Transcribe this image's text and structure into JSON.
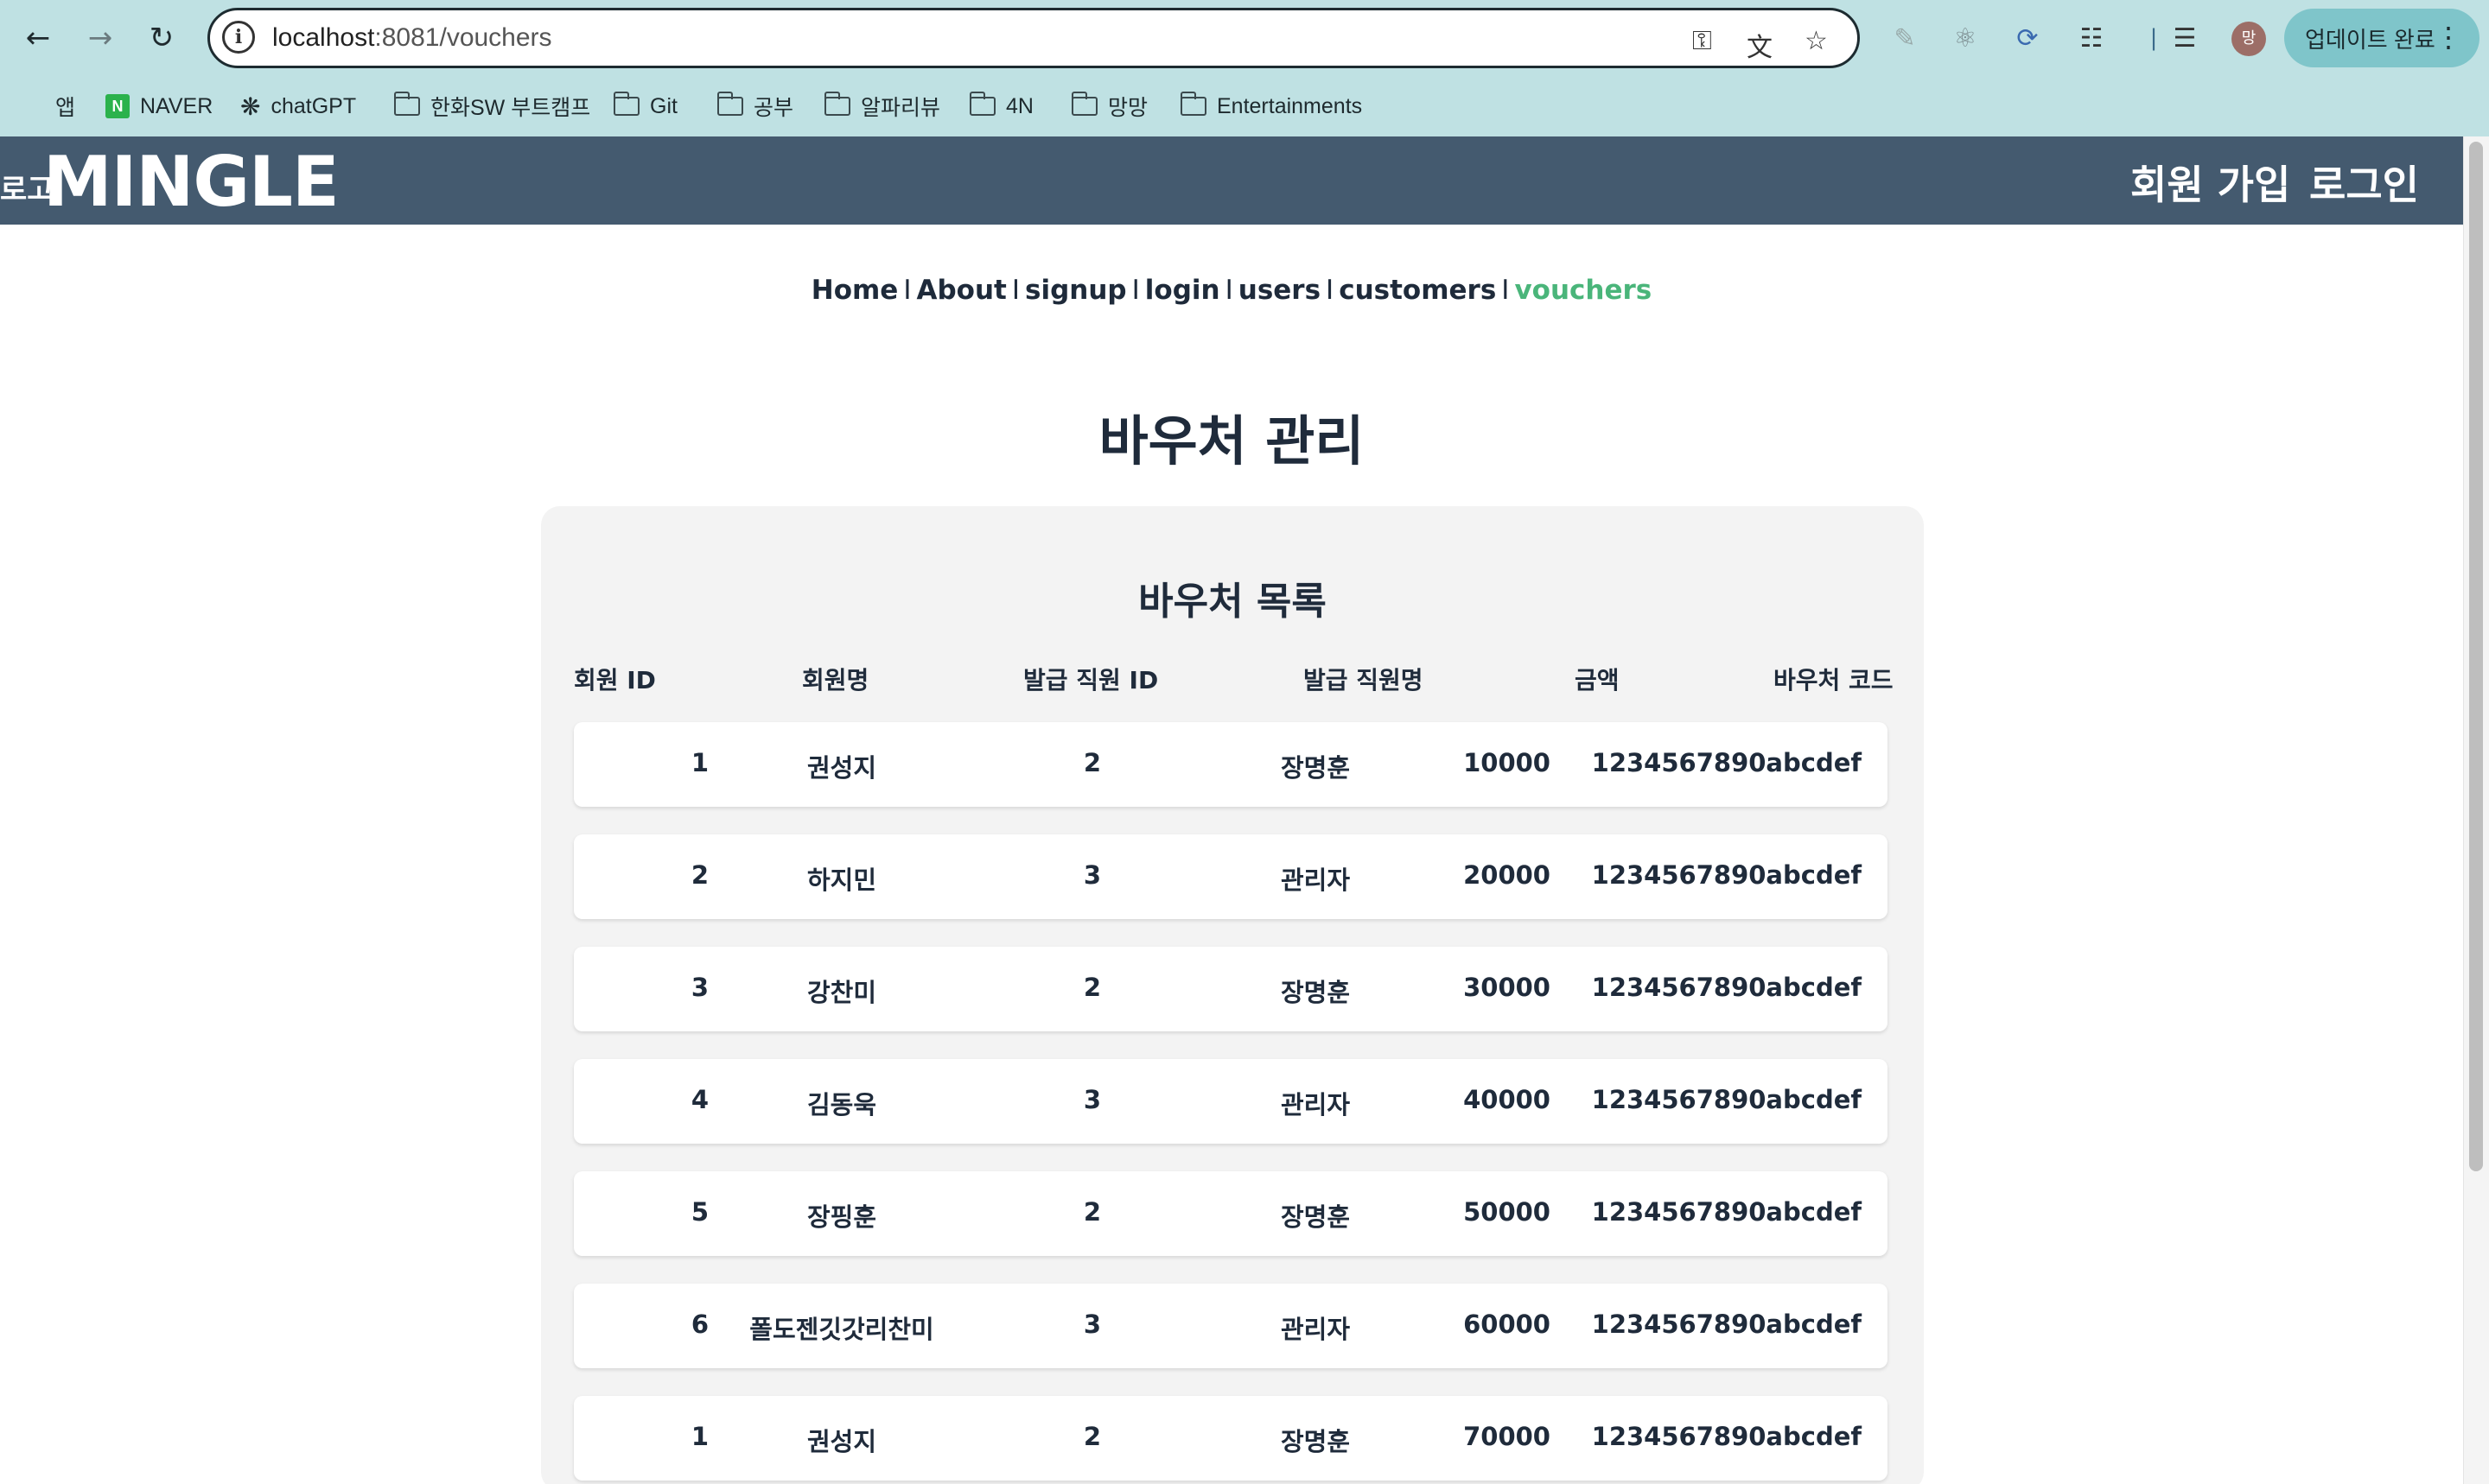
{
  "browser": {
    "url_host": "localhost",
    "url_path": ":8081/vouchers",
    "update_label": "업데이트 완료",
    "avatar_initial": "망"
  },
  "bookmarks": [
    {
      "label": "앱",
      "icon": "apps-grid-icon"
    },
    {
      "label": "NAVER",
      "icon": "naver-icon"
    },
    {
      "label": "chatGPT",
      "icon": "chatgpt-icon"
    },
    {
      "label": "한화SW 부트캠프",
      "icon": "folder-icon"
    },
    {
      "label": "Git",
      "icon": "folder-icon"
    },
    {
      "label": "공부",
      "icon": "folder-icon"
    },
    {
      "label": "알파리뷰",
      "icon": "folder-icon"
    },
    {
      "label": "4N",
      "icon": "folder-icon"
    },
    {
      "label": "망망",
      "icon": "folder-icon"
    },
    {
      "label": "Entertainments",
      "icon": "folder-icon"
    }
  ],
  "header": {
    "logo_small": "로고",
    "logo_main": "MINGLE",
    "signup": "회원 가입",
    "login": "로그인",
    "bg_color": "#445a6f"
  },
  "subnav": {
    "items": [
      "Home",
      "About",
      "signup",
      "login",
      "users",
      "customers",
      "vouchers"
    ],
    "separator": "I",
    "active_color": "#4ab57a"
  },
  "page": {
    "title": "바우처 관리",
    "card_title": "바우처 목록"
  },
  "table": {
    "columns": [
      "회원 ID",
      "회원명",
      "발급 직원 ID",
      "발급 직원명",
      "금액",
      "바우처 코드"
    ],
    "rows": [
      [
        "1",
        "권성지",
        "2",
        "장명훈",
        "10000",
        "1234567890abcdef"
      ],
      [
        "2",
        "하지민",
        "3",
        "관리자",
        "20000",
        "1234567890abcdef"
      ],
      [
        "3",
        "강찬미",
        "2",
        "장명훈",
        "30000",
        "1234567890abcdef"
      ],
      [
        "4",
        "김동욱",
        "3",
        "관리자",
        "40000",
        "1234567890abcdef"
      ],
      [
        "5",
        "장핑훈",
        "2",
        "장명훈",
        "50000",
        "1234567890abcdef"
      ],
      [
        "6",
        "폴도젠깃갓리찬미",
        "3",
        "관리자",
        "60000",
        "1234567890abcdef"
      ],
      [
        "1",
        "권성지",
        "2",
        "장명훈",
        "70000",
        "1234567890abcdef"
      ]
    ]
  }
}
